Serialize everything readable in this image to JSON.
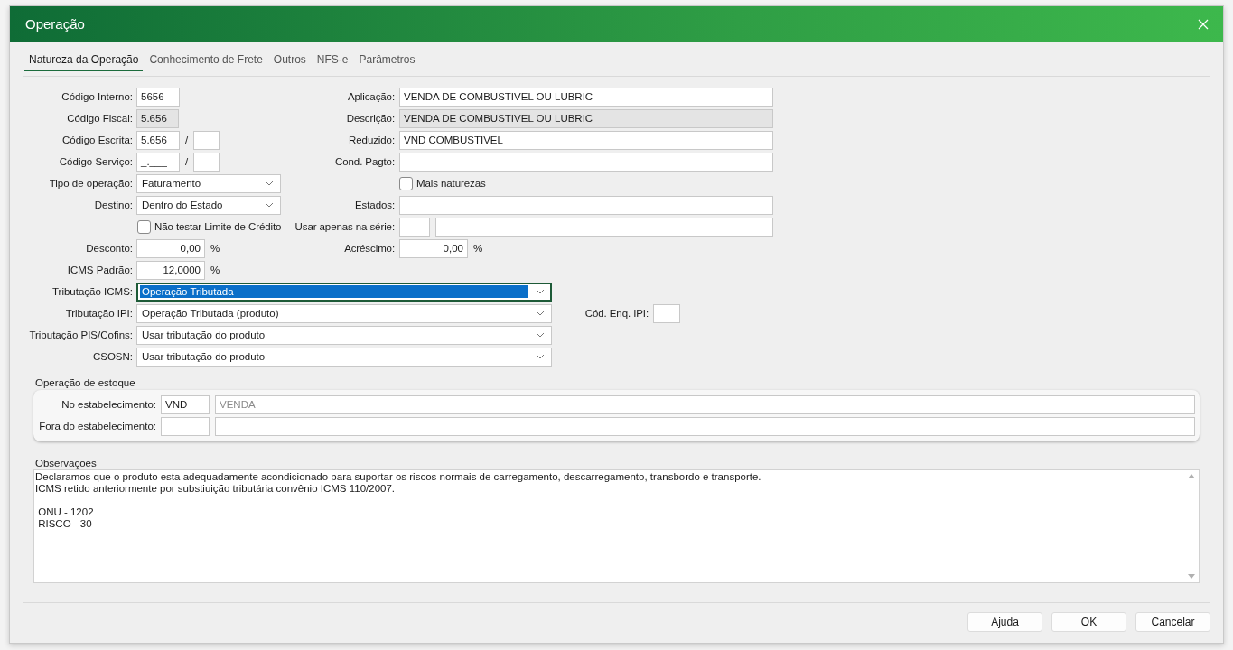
{
  "window": {
    "title": "Operação"
  },
  "tabs": [
    {
      "label": "Natureza da Operação",
      "selected": true
    },
    {
      "label": "Conhecimento de Frete",
      "selected": false
    },
    {
      "label": "Outros",
      "selected": false
    },
    {
      "label": "NFS-e",
      "selected": false
    },
    {
      "label": "Parâmetros",
      "selected": false
    }
  ],
  "form": {
    "codigo_interno": {
      "label": "Código Interno:",
      "value": "5656"
    },
    "aplicacao": {
      "label": "Aplicação:",
      "value": "VENDA DE COMBUSTIVEL OU LUBRIC"
    },
    "codigo_fiscal": {
      "label": "Código Fiscal:",
      "value": "5.656",
      "disabled": true
    },
    "descricao": {
      "label": "Descrição:",
      "value": "VENDA DE COMBUSTIVEL OU LUBRIC",
      "disabled": true
    },
    "codigo_escrita": {
      "label": "Código Escrita:",
      "value": "5.656",
      "separator": "/"
    },
    "reduzido": {
      "label": "Reduzido:",
      "value": "VND COMBUSTIVEL"
    },
    "codigo_servico": {
      "label": "Código Serviço:",
      "value": "_.___",
      "separator": "/"
    },
    "cond_pagto": {
      "label": "Cond. Pagto:"
    },
    "tipo_operacao": {
      "label": "Tipo de operação:",
      "value": "Faturamento"
    },
    "mais_naturezas": {
      "label": "Mais naturezas",
      "checked": false
    },
    "destino": {
      "label": "Destino:",
      "value": "Dentro do Estado"
    },
    "estados": {
      "label": "Estados:"
    },
    "nao_testar_limite": {
      "label": "Não testar Limite de Crédito",
      "checked": false
    },
    "usar_apenas_serie": {
      "label": "Usar apenas na série:"
    },
    "desconto": {
      "label": "Desconto:",
      "value": "0,00",
      "unit": "%"
    },
    "acrescimo": {
      "label": "Acréscimo:",
      "value": "0,00",
      "unit": "%"
    },
    "icms_padrao": {
      "label": "ICMS Padrão:",
      "value": "12,0000",
      "unit": "%"
    },
    "tributacao_icms": {
      "label": "Tributação ICMS:",
      "value": "Operação Tributada",
      "focused": true
    },
    "tributacao_ipi": {
      "label": "Tributação IPI:",
      "value": "Operação Tributada (produto)",
      "focused": false
    },
    "cod_enq_ipi": {
      "label": "Cód. Enq. IPI:"
    },
    "tributacao_pis_cofins": {
      "label": "Tributação PIS/Cofins:",
      "value": "Usar tributação do produto",
      "focused": false
    },
    "csosn": {
      "label": "CSOSN:",
      "value": "Usar tributação do produto",
      "focused": false
    }
  },
  "stock_operation": {
    "title": "Operação de estoque",
    "rows": [
      {
        "label": "No estabelecimento:",
        "code": "VND",
        "description": "VENDA"
      },
      {
        "label": "Fora do estabelecimento:"
      }
    ]
  },
  "observations": {
    "title": "Observações",
    "text": "Declaramos que o produto esta adequadamente acondicionado para suportar os riscos normais de carregamento, descarregamento, transbordo e transporte.\nICMS retido anteriormente por substiuição tributária convênio ICMS 110/2007.\n\n ONU - 1202\n RISCO - 30"
  },
  "buttons": [
    {
      "label": "Ajuda"
    },
    {
      "label": "OK"
    },
    {
      "label": "Cancelar"
    }
  ]
}
